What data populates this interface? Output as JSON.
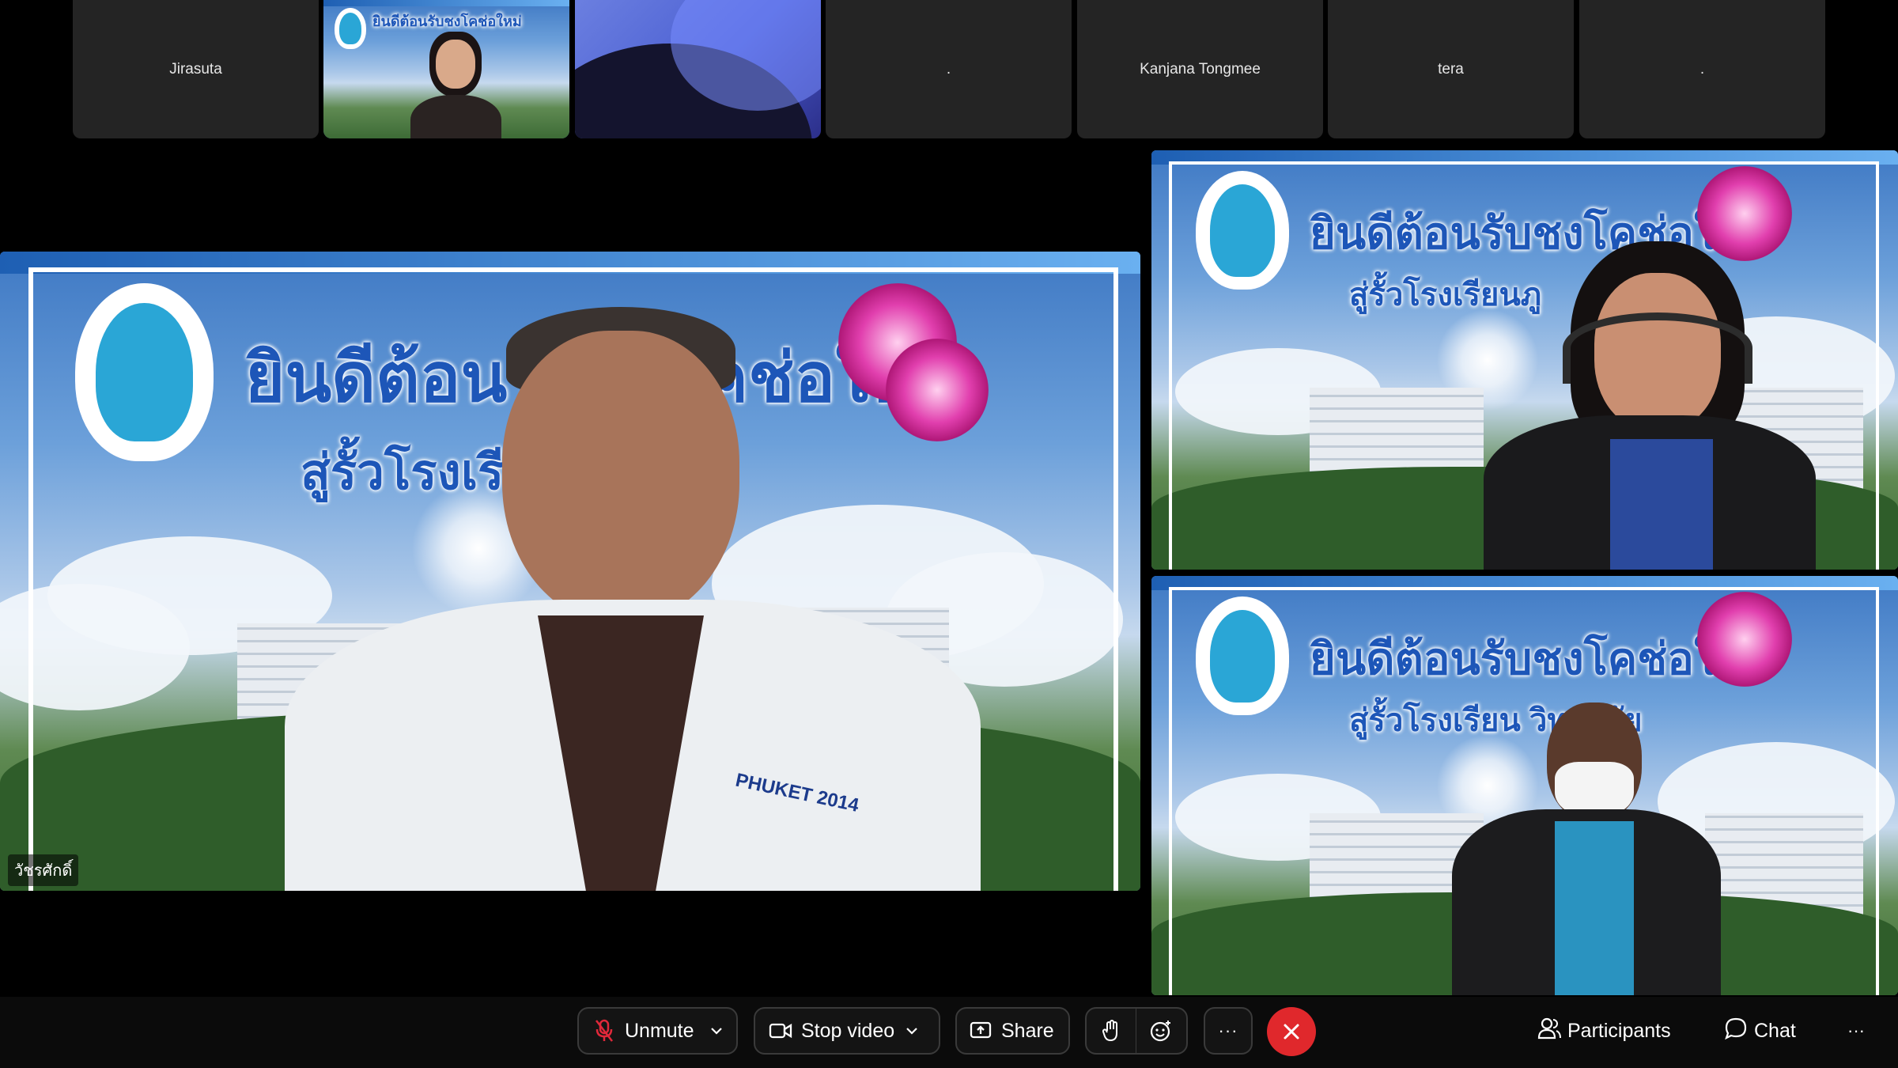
{
  "thumbnails": [
    {
      "name": "Jirasuta"
    },
    {
      "name": ""
    },
    {
      "name": ""
    },
    {
      "name": "."
    },
    {
      "name": "Kanjana Tongmee"
    },
    {
      "name": "tera"
    },
    {
      "name": "."
    }
  ],
  "main_tile": {
    "participant_name": "วัชรศักดิ์",
    "background_title": "ยินดีต้อนรับชงโคช่อใหม่",
    "background_subtitle": "สู่รั้วโรงเรียน",
    "shirt_text": "PHUKET 2014"
  },
  "right_tiles": [
    {
      "background_title": "ยินดีต้อนรับชงโคช่อใหม่",
      "background_subtitle": "สู่รั้วโรงเรียนภู"
    },
    {
      "background_title": "ยินดีต้อนรับชงโคช่อใหม่",
      "background_subtitle": "สู่รั้วโรงเรียน วิทยาลัย"
    }
  ],
  "toolbar": {
    "unmute_label": "Unmute",
    "stop_video_label": "Stop video",
    "share_label": "Share",
    "more_label": "···",
    "participants_label": "Participants",
    "chat_label": "Chat",
    "overflow_label": "···"
  },
  "colors": {
    "end_call": "#e0282c",
    "muted_icon": "#e0283a",
    "background_title_blue": "#1d56b8"
  }
}
